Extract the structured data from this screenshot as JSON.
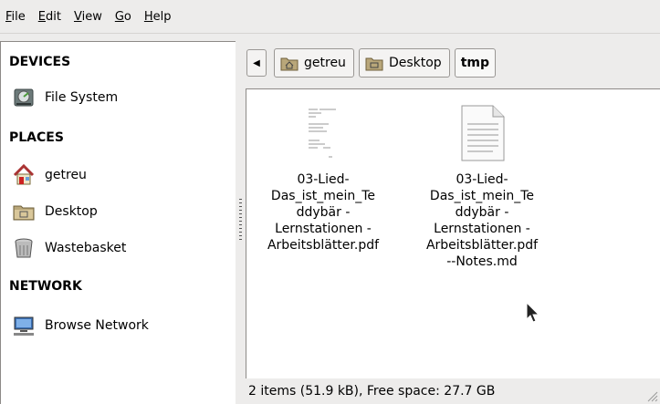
{
  "menubar": {
    "items": [
      "File",
      "Edit",
      "View",
      "Go",
      "Help"
    ]
  },
  "sidebar": {
    "sections": [
      {
        "title": "DEVICES",
        "items": [
          {
            "label": "File System",
            "icon": "drive-icon"
          }
        ]
      },
      {
        "title": "PLACES",
        "items": [
          {
            "label": "getreu",
            "icon": "home-icon"
          },
          {
            "label": "Desktop",
            "icon": "desktop-folder-icon"
          },
          {
            "label": "Wastebasket",
            "icon": "trash-icon"
          }
        ]
      },
      {
        "title": "NETWORK",
        "items": [
          {
            "label": "Browse Network",
            "icon": "network-icon"
          }
        ]
      }
    ]
  },
  "pathbar": {
    "crumbs": [
      "getreu",
      "Desktop",
      "tmp"
    ],
    "active": "tmp"
  },
  "files": [
    {
      "name_lines": [
        "03-Lied-",
        "Das_ist_mein_Te",
        "ddybär -",
        "Lernstationen -",
        "Arbeitsblätter.pdf"
      ],
      "icon": "pdf-thumbnail-icon"
    },
    {
      "name_lines": [
        "03-Lied-",
        "Das_ist_mein_Te",
        "ddybär -",
        "Lernstationen -",
        "Arbeitsblätter.pdf",
        "--Notes.md"
      ],
      "icon": "text-document-icon"
    }
  ],
  "status": {
    "text": "2 items (51.9 kB), Free space: 27.7 GB"
  }
}
